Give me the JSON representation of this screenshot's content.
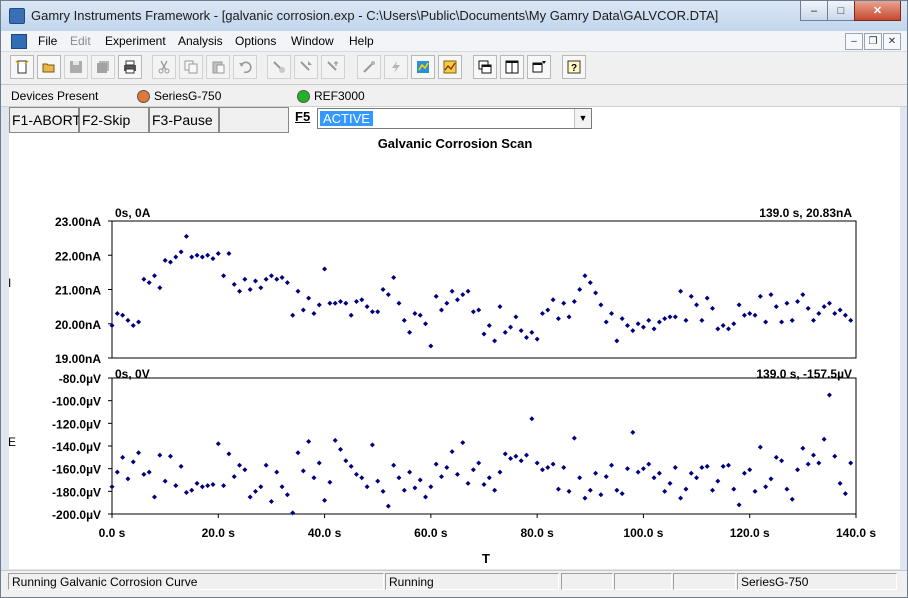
{
  "window": {
    "title": "Gamry Instruments Framework - [galvanic corrosion.exp - C:\\Users\\Public\\Documents\\My Gamry Data\\GALVCOR.DTA]",
    "min_glyph": "–",
    "max_glyph": "□",
    "close_glyph": "✕"
  },
  "menu": {
    "items": [
      "File",
      "Edit",
      "Experiment",
      "Analysis",
      "Options",
      "Window",
      "Help"
    ],
    "mdi_min": "–",
    "mdi_restore": "❐",
    "mdi_close": "✕"
  },
  "toolbar": {
    "icons": [
      "new-icon",
      "open-icon",
      "save-icon",
      "save-all-icon",
      "print-icon",
      "cut-icon",
      "copy-icon",
      "paste-icon",
      "undo-icon",
      "find-icon",
      "find-next-icon",
      "replace-icon",
      "run-icon",
      "lightning-icon",
      "script-icon",
      "chart-icon",
      "cascade-icon",
      "tile-icon",
      "window-list-icon",
      "help-icon"
    ],
    "help_glyph": "?"
  },
  "devices": {
    "label": "Devices Present",
    "items": [
      {
        "name": "SeriesG-750",
        "color": "#e07838"
      },
      {
        "name": "REF3000",
        "color": "#22b422"
      }
    ]
  },
  "controls": {
    "f1": "F1-ABORT",
    "f2": "F2-Skip",
    "f3": "F3-Pause",
    "f5_label": "F5",
    "combo_value": "ACTIVE",
    "combo_arrow": "▼"
  },
  "plot": {
    "title": "Galvanic Corrosion Scan",
    "xlabel": "T",
    "marker_color": "#00007f"
  },
  "chart_data": [
    {
      "type": "scatter",
      "name": "current",
      "ylabel": "I",
      "xlim": [
        0,
        140
      ],
      "ylim": [
        19,
        23
      ],
      "yticks": [
        "23.00nA",
        "22.00nA",
        "21.00nA",
        "20.00nA",
        "19.00nA"
      ],
      "corner_left": "0s, 0A",
      "corner_right": "139.0 s, 20.83nA",
      "x": [
        0.0,
        1.0,
        2.0,
        3.0,
        4.0,
        5.0,
        6.0,
        7.0,
        8.0,
        9.0,
        10.0,
        11.0,
        12.0,
        13.0,
        14.0,
        15.0,
        16.0,
        17.0,
        18.0,
        19.0,
        20.0,
        21.0,
        22.0,
        23.0,
        24.0,
        25.0,
        26.0,
        27.0,
        28.0,
        29.0,
        30.0,
        31.0,
        32.0,
        33.0,
        34.0,
        35.0,
        36.0,
        37.0,
        38.0,
        39.0,
        40.0,
        41.0,
        42.0,
        43.0,
        44.0,
        45.0,
        46.0,
        47.0,
        48.0,
        49.0,
        50.0,
        51.0,
        52.0,
        53.0,
        54.0,
        55.0,
        56.0,
        57.0,
        58.0,
        59.0,
        60.0,
        61.0,
        62.0,
        63.0,
        64.0,
        65.0,
        66.0,
        67.0,
        68.0,
        69.0,
        70.0,
        71.0,
        72.0,
        73.0,
        74.0,
        75.0,
        76.0,
        77.0,
        78.0,
        79.0,
        80.0,
        81.0,
        82.0,
        83.0,
        84.0,
        85.0,
        86.0,
        87.0,
        88.0,
        89.0,
        90.0,
        91.0,
        92.0,
        93.0,
        94.0,
        95.0,
        96.0,
        97.0,
        98.0,
        99.0,
        100.0,
        101.0,
        102.0,
        103.0,
        104.0,
        105.0,
        106.0,
        107.0,
        108.0,
        109.0,
        110.0,
        111.0,
        112.0,
        113.0,
        114.0,
        115.0,
        116.0,
        117.0,
        118.0,
        119.0,
        120.0,
        121.0,
        122.0,
        123.0,
        124.0,
        125.0,
        126.0,
        127.0,
        128.0,
        129.0,
        130.0,
        131.0,
        132.0,
        133.0,
        134.0,
        135.0,
        136.0,
        137.0,
        138.0,
        139.0
      ],
      "y": [
        19.95,
        20.3,
        20.25,
        20.1,
        19.95,
        20.05,
        21.3,
        21.2,
        21.4,
        21.05,
        21.85,
        21.8,
        21.95,
        22.1,
        22.55,
        21.95,
        22.0,
        21.95,
        22.0,
        21.9,
        22.05,
        21.4,
        22.05,
        21.15,
        20.95,
        21.3,
        21.0,
        21.25,
        21.05,
        21.3,
        21.4,
        21.3,
        21.35,
        21.2,
        20.25,
        20.95,
        20.4,
        20.75,
        20.3,
        20.55,
        21.6,
        20.6,
        20.6,
        20.65,
        20.6,
        20.25,
        20.65,
        20.7,
        20.5,
        20.35,
        20.35,
        21.0,
        20.85,
        21.35,
        20.6,
        20.1,
        19.75,
        20.3,
        20.25,
        20.0,
        19.35,
        20.8,
        20.4,
        20.6,
        20.95,
        20.7,
        20.85,
        20.95,
        20.35,
        20.4,
        19.7,
        19.95,
        19.5,
        20.5,
        19.75,
        19.9,
        20.2,
        19.8,
        19.6,
        19.75,
        19.55,
        20.3,
        20.4,
        20.7,
        20.15,
        20.6,
        20.2,
        20.65,
        21.0,
        21.4,
        21.2,
        20.9,
        20.55,
        20.05,
        20.3,
        19.5,
        20.15,
        19.95,
        19.8,
        20.0,
        19.9,
        20.1,
        19.85,
        20.05,
        20.15,
        20.2,
        20.2,
        20.95,
        20.1,
        20.8,
        20.55,
        20.1,
        20.75,
        20.45,
        19.85,
        19.95,
        19.85,
        20.0,
        20.55,
        20.25,
        20.3,
        20.25,
        20.8,
        20.05,
        20.85,
        20.5,
        20.05,
        20.6,
        20.1,
        20.65,
        20.85,
        20.45,
        20.1,
        20.3,
        20.5,
        20.6,
        20.3,
        20.4,
        20.25,
        20.1,
        19.85,
        20.1,
        20.65
      ]
    },
    {
      "type": "scatter",
      "name": "voltage",
      "ylabel": "E",
      "xlim": [
        0,
        140
      ],
      "ylim": [
        -200,
        -80
      ],
      "yticks": [
        "-80.0µV",
        "-100.0µV",
        "-120.0µV",
        "-140.0µV",
        "-160.0µV",
        "-180.0µV",
        "-200.0µV"
      ],
      "xticks": [
        "0.0 s",
        "20.0 s",
        "40.0 s",
        "60.0 s",
        "80.0 s",
        "100.0 s",
        "120.0 s",
        "140.0 s"
      ],
      "corner_left": "0s, 0V",
      "corner_right": "139.0 s, -157.5µV",
      "x": [
        0.0,
        1.0,
        2.0,
        3.0,
        4.0,
        5.0,
        6.0,
        7.0,
        8.0,
        9.0,
        10.0,
        11.0,
        12.0,
        13.0,
        14.0,
        15.0,
        16.0,
        17.0,
        18.0,
        19.0,
        20.0,
        21.0,
        22.0,
        23.0,
        24.0,
        25.0,
        26.0,
        27.0,
        28.0,
        29.0,
        30.0,
        31.0,
        32.0,
        33.0,
        34.0,
        35.0,
        36.0,
        37.0,
        38.0,
        39.0,
        40.0,
        41.0,
        42.0,
        43.0,
        44.0,
        45.0,
        46.0,
        47.0,
        48.0,
        49.0,
        50.0,
        51.0,
        52.0,
        53.0,
        54.0,
        55.0,
        56.0,
        57.0,
        58.0,
        59.0,
        60.0,
        61.0,
        62.0,
        63.0,
        64.0,
        65.0,
        66.0,
        67.0,
        68.0,
        69.0,
        70.0,
        71.0,
        72.0,
        73.0,
        74.0,
        75.0,
        76.0,
        77.0,
        78.0,
        79.0,
        80.0,
        81.0,
        82.0,
        83.0,
        84.0,
        85.0,
        86.0,
        87.0,
        88.0,
        89.0,
        90.0,
        91.0,
        92.0,
        93.0,
        94.0,
        95.0,
        96.0,
        97.0,
        98.0,
        99.0,
        100.0,
        101.0,
        102.0,
        103.0,
        104.0,
        105.0,
        106.0,
        107.0,
        108.0,
        109.0,
        110.0,
        111.0,
        112.0,
        113.0,
        114.0,
        115.0,
        116.0,
        117.0,
        118.0,
        119.0,
        120.0,
        121.0,
        122.0,
        123.0,
        124.0,
        125.0,
        126.0,
        127.0,
        128.0,
        129.0,
        130.0,
        131.0,
        132.0,
        133.0,
        134.0,
        135.0,
        136.0,
        137.0,
        138.0,
        139.0
      ],
      "y": [
        -176,
        -163,
        -150,
        -169,
        -154,
        -146,
        -165,
        -163,
        -185,
        -148,
        -171,
        -149,
        -175,
        -158,
        -181,
        -179,
        -173,
        -176,
        -175,
        -174,
        -138,
        -175,
        -147,
        -167,
        -157,
        -161,
        -185,
        -180,
        -176,
        -157,
        -189,
        -163,
        -176,
        -183,
        -199,
        -146,
        -162,
        -136,
        -168,
        -155,
        -188,
        -172,
        -135,
        -143,
        -153,
        -158,
        -165,
        -168,
        -176,
        -139,
        -171,
        -180,
        -193,
        -157,
        -168,
        -179,
        -163,
        -177,
        -170,
        -185,
        -176,
        -156,
        -167,
        -159,
        -145,
        -165,
        -137,
        -173,
        -161,
        -155,
        -174,
        -168,
        -179,
        -163,
        -147,
        -151,
        -149,
        -153,
        -148,
        -116,
        -155,
        -161,
        -159,
        -156,
        -178,
        -159,
        -180,
        -133,
        -168,
        -186,
        -179,
        -164,
        -183,
        -167,
        -157,
        -179,
        -182,
        -160,
        -128,
        -163,
        -160,
        -156,
        -168,
        -164,
        -180,
        -173,
        -159,
        -186,
        -178,
        -164,
        -168,
        -159,
        -158,
        -179,
        -171,
        -158,
        -157,
        -178,
        -192,
        -164,
        -161,
        -180,
        -141,
        -176,
        -169,
        -150,
        -153,
        -178,
        -187,
        -161,
        -142,
        -156,
        -148,
        -155,
        -134,
        -95,
        -149,
        -173,
        -182,
        -155
      ]
    }
  ],
  "statusbar": {
    "message": "Running Galvanic Corrosion Curve",
    "state": "Running",
    "blank1": "",
    "blank2": "",
    "blank3": "",
    "device": "SeriesG-750"
  }
}
